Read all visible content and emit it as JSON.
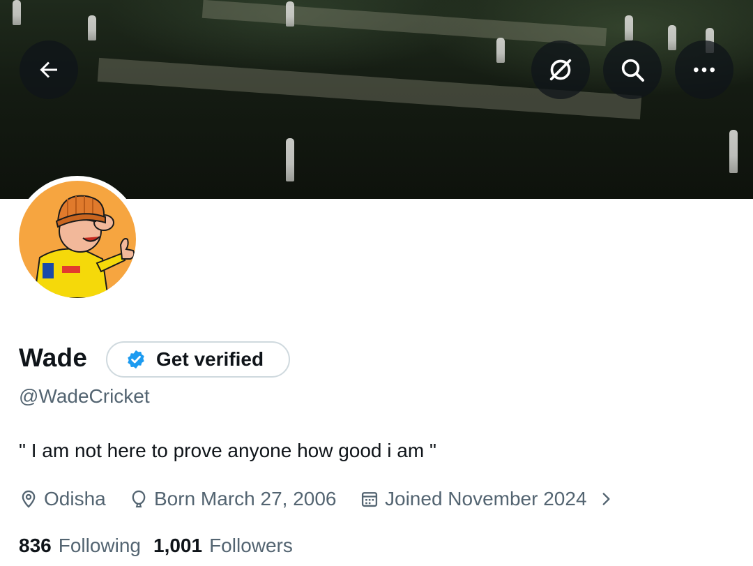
{
  "header": {
    "back_icon": "arrow-left-icon",
    "grok_icon": "slashed-circle-icon",
    "search_icon": "search-icon",
    "more_icon": "more-horizontal-icon"
  },
  "profile": {
    "name": "Wade",
    "verify_label": "Get verified",
    "handle": "@WadeCricket",
    "bio": "\" I am not here to prove anyone how good i am \"",
    "location": "Odisha",
    "birthday": "Born March 27, 2006",
    "joined": "Joined November 2024"
  },
  "stats": {
    "following_count": "836",
    "following_label": "Following",
    "followers_count": "1,001",
    "followers_label": "Followers"
  },
  "colors": {
    "verified_blue": "#1d9bf0",
    "secondary_text": "#536471",
    "avatar_bg": "#f6a540"
  }
}
